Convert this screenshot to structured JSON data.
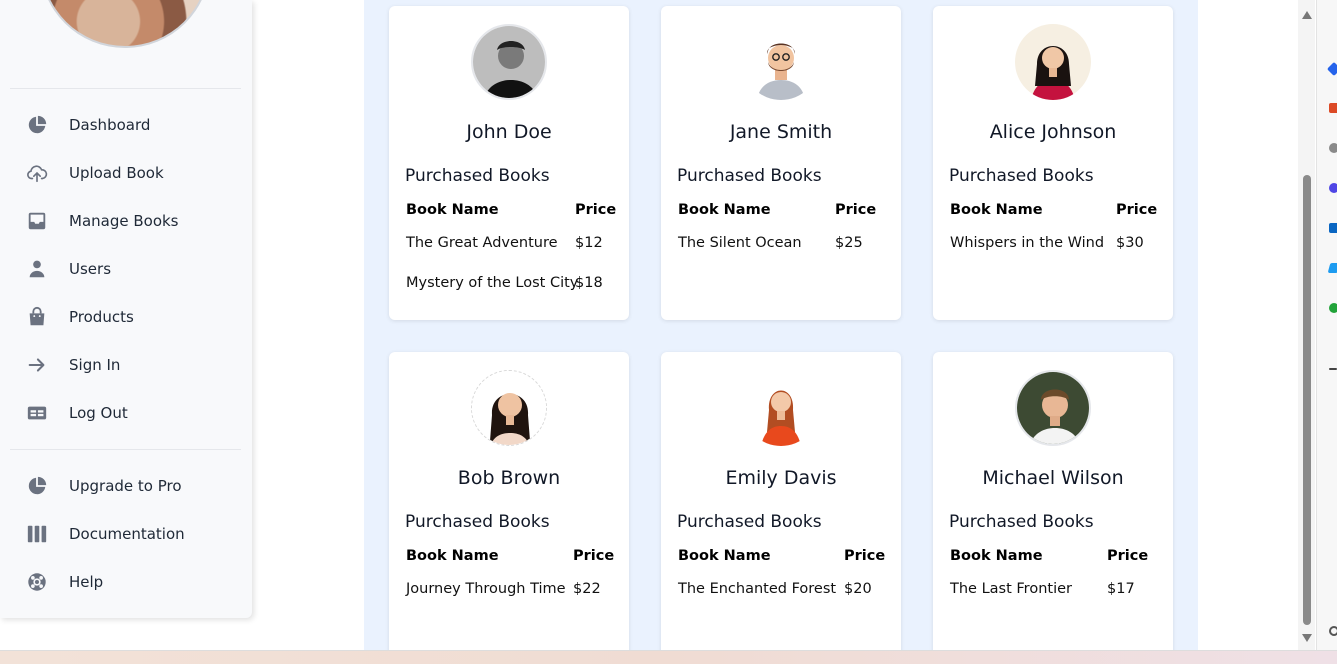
{
  "sidebar": {
    "items": [
      {
        "label": "Dashboard",
        "icon": "pie-chart-icon"
      },
      {
        "label": "Upload Book",
        "icon": "cloud-upload-icon"
      },
      {
        "label": "Manage Books",
        "icon": "inbox-icon"
      },
      {
        "label": "Users",
        "icon": "user-icon"
      },
      {
        "label": "Products",
        "icon": "shopping-bag-icon"
      },
      {
        "label": "Sign In",
        "icon": "arrow-right-icon"
      },
      {
        "label": "Log Out",
        "icon": "table-icon"
      }
    ],
    "secondary_items": [
      {
        "label": "Upgrade to Pro",
        "icon": "pie-chart-icon"
      },
      {
        "label": "Documentation",
        "icon": "columns-icon"
      },
      {
        "label": "Help",
        "icon": "life-buoy-icon"
      }
    ]
  },
  "labels": {
    "purchased_books": "Purchased Books",
    "book_name": "Book Name",
    "price": "Price"
  },
  "users": [
    {
      "name": "John Doe",
      "books": [
        {
          "title": "The Great Adventure",
          "price": "$12"
        },
        {
          "title": "Mystery of the Lost City",
          "price": "$18"
        }
      ]
    },
    {
      "name": "Jane Smith",
      "books": [
        {
          "title": "The Silent Ocean",
          "price": "$25"
        }
      ]
    },
    {
      "name": "Alice Johnson",
      "books": [
        {
          "title": "Whispers in the Wind",
          "price": "$30"
        }
      ]
    },
    {
      "name": "Bob Brown",
      "books": [
        {
          "title": "Journey Through Time",
          "price": "$22"
        }
      ]
    },
    {
      "name": "Emily Davis",
      "books": [
        {
          "title": "The Enchanted Forest",
          "price": "$20"
        }
      ]
    },
    {
      "name": "Michael Wilson",
      "books": [
        {
          "title": "The Last Frontier",
          "price": "$17"
        }
      ]
    }
  ],
  "colors": {
    "sidebar_bg": "#f8f9fb",
    "main_bg": "#eaf2fe",
    "icon_gray": "#6b7280"
  }
}
